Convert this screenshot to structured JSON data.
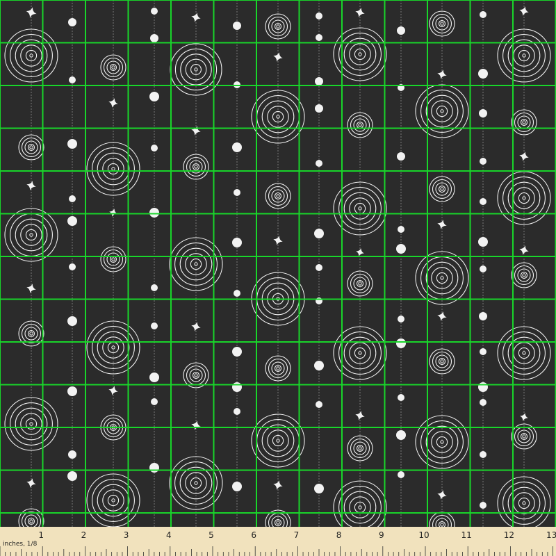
{
  "colors": {
    "background": "#2b2b2b",
    "grid": "#18d62a",
    "motif": "#f2f2f2",
    "ruler": "#f1e2bd",
    "ruler_text": "#222222"
  },
  "ruler": {
    "unit_label": "inches, 1/8",
    "numbers": [
      "1",
      "2",
      "3",
      "4",
      "5",
      "6",
      "7",
      "8",
      "9",
      "10",
      "11",
      "12",
      "13"
    ]
  },
  "motifs": [
    "concentric-circles-icon",
    "polka-dot-icon",
    "sparkle-star-icon",
    "hanging-thread-line"
  ]
}
